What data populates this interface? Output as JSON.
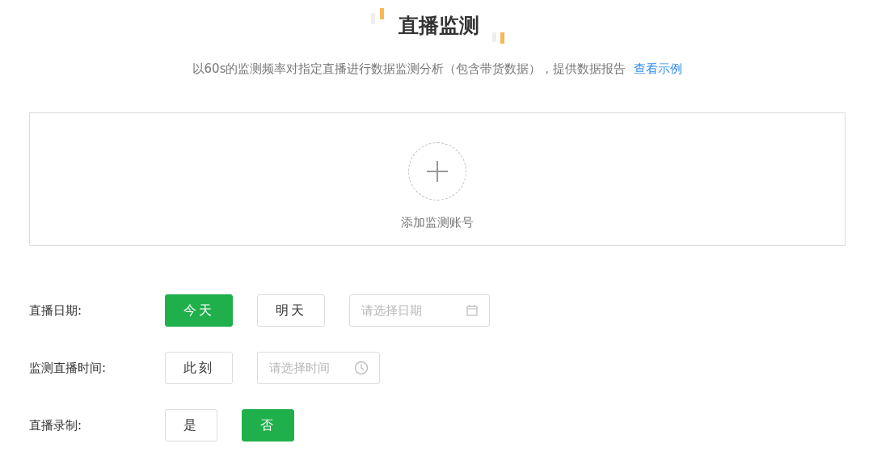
{
  "title": "直播监测",
  "description": {
    "text": "以60s的监测频率对指定直播进行数据监测分析（包含带货数据），提供数据报告",
    "link": "查看示例"
  },
  "add_account": {
    "label": "添加监测账号"
  },
  "rows": [
    {
      "label": "直播日期:",
      "controls": [
        {
          "kind": "option",
          "label": "今天",
          "selected": true
        },
        {
          "kind": "option",
          "label": "明天",
          "selected": false
        },
        {
          "kind": "date-field",
          "placeholder": "请选择日期"
        }
      ]
    },
    {
      "label": "监测直播时间:",
      "controls": [
        {
          "kind": "option",
          "label": "此刻",
          "selected": false
        },
        {
          "kind": "time-field",
          "placeholder": "请选择时间"
        }
      ]
    },
    {
      "label": "直播录制:",
      "controls": [
        {
          "kind": "option",
          "label": "是",
          "selected": false
        },
        {
          "kind": "option",
          "label": "否",
          "selected": true
        }
      ]
    }
  ]
}
